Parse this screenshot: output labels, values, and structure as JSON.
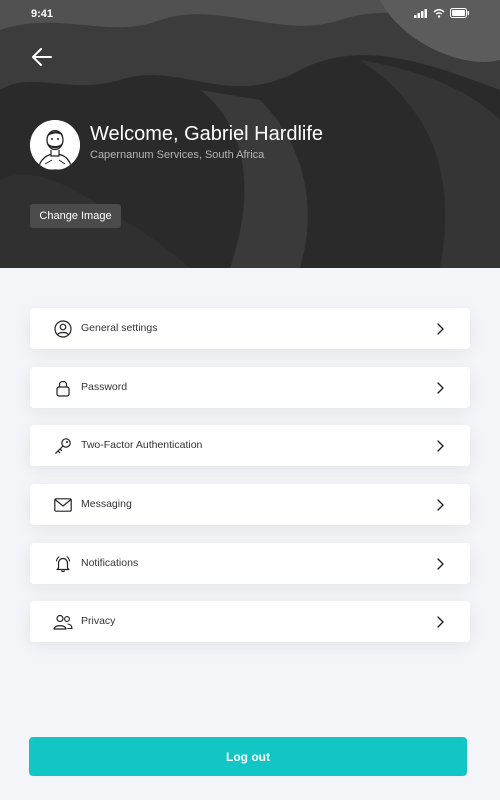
{
  "status_bar": {
    "time": "9:41",
    "icons": [
      "signal-icon",
      "wifi-icon",
      "battery-icon"
    ]
  },
  "header": {
    "back_icon": "arrow-left-icon",
    "welcome": "Welcome, Gabriel Hardlife",
    "location": "Capernanum Services, South Africa",
    "change_image_label": "Change Image"
  },
  "menu": {
    "items": [
      {
        "label": "General settings",
        "icon": "user-circle-icon"
      },
      {
        "label": "Password",
        "icon": "lock-icon"
      },
      {
        "label": "Two-Factor Authentication",
        "icon": "key-icon"
      },
      {
        "label": "Messaging",
        "icon": "envelope-icon"
      },
      {
        "label": "Notifications",
        "icon": "bell-icon"
      },
      {
        "label": "Privacy",
        "icon": "users-icon"
      }
    ]
  },
  "logout_label": "Log out",
  "colors": {
    "header_bg": "#262626",
    "page_bg": "#f4f5f8",
    "accent": "#13c6c6",
    "card_bg": "#ffffff"
  }
}
